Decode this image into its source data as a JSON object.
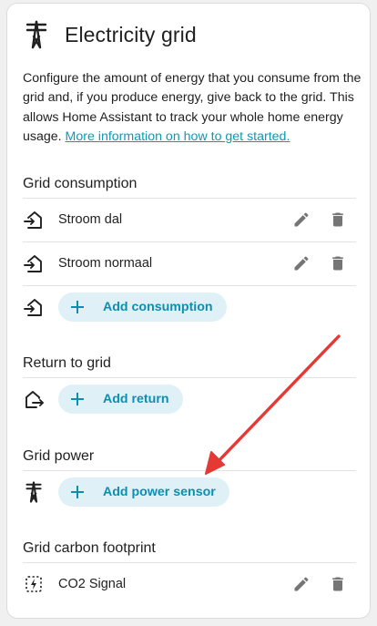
{
  "card": {
    "title": "Electricity grid",
    "title_icon": "transmission-tower-icon",
    "description": "Configure the amount of energy that you consume from the grid and, if you produce energy, give back to the grid. This allows Home Assistant to track your whole home energy usage. ",
    "more_info_link": "More information on how to get started."
  },
  "sections": {
    "consumption": {
      "title": "Grid consumption",
      "icon": "transmission-tower-import-icon",
      "items": [
        {
          "label": "Stroom dal"
        },
        {
          "label": "Stroom normaal"
        }
      ],
      "add_label": "Add consumption"
    },
    "return": {
      "title": "Return to grid",
      "icon": "transmission-tower-export-icon",
      "add_label": "Add return"
    },
    "power": {
      "title": "Grid power",
      "icon": "transmission-tower-icon",
      "add_label": "Add power sensor"
    },
    "carbon": {
      "title": "Grid carbon footprint",
      "icon": "carbon-signal-icon",
      "items": [
        {
          "label": "CO2 Signal"
        }
      ]
    }
  },
  "colors": {
    "accent": "#0b8fb0",
    "button_bg": "#dff1f7",
    "icon": "#212121",
    "action_icon": "#757575",
    "annotation_arrow": "#e53935"
  }
}
